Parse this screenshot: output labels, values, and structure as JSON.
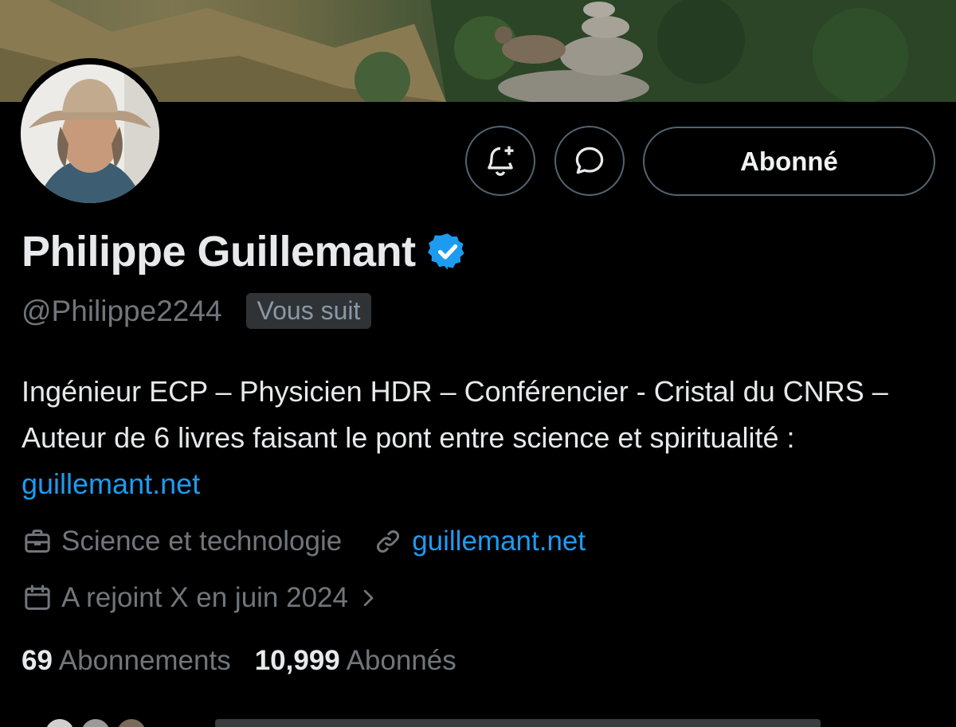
{
  "colors": {
    "background": "#000000",
    "text_primary": "#e7e9ea",
    "text_secondary": "#71767b",
    "link": "#1d9bf0",
    "verified_badge": "#1d9bf0",
    "button_border": "#536471"
  },
  "header": {
    "banner": {
      "icon": "landscape-banner"
    },
    "avatar": {
      "icon": "profile-avatar"
    }
  },
  "actions": {
    "notify": {
      "icon": "bell-plus-icon"
    },
    "message": {
      "icon": "chat-bubble-icon"
    },
    "follow_label": "Abonné"
  },
  "profile": {
    "name": "Philippe Guillemant",
    "handle": "@Philippe2244",
    "follows_you": "Vous suit",
    "bio_text": "Ingénieur ECP – Physicien HDR – Conférencier - Cristal du CNRS – Auteur de 6 livres faisant le pont entre science et spiritualité : ",
    "bio_link": "guillemant.net",
    "category": "Science et technologie",
    "website": "guillemant.net",
    "joined": "A rejoint X en juin 2024"
  },
  "stats": {
    "following_count": "69",
    "following_label": "Abonnements",
    "followers_count": "10,999",
    "followers_label": "Abonnés"
  }
}
